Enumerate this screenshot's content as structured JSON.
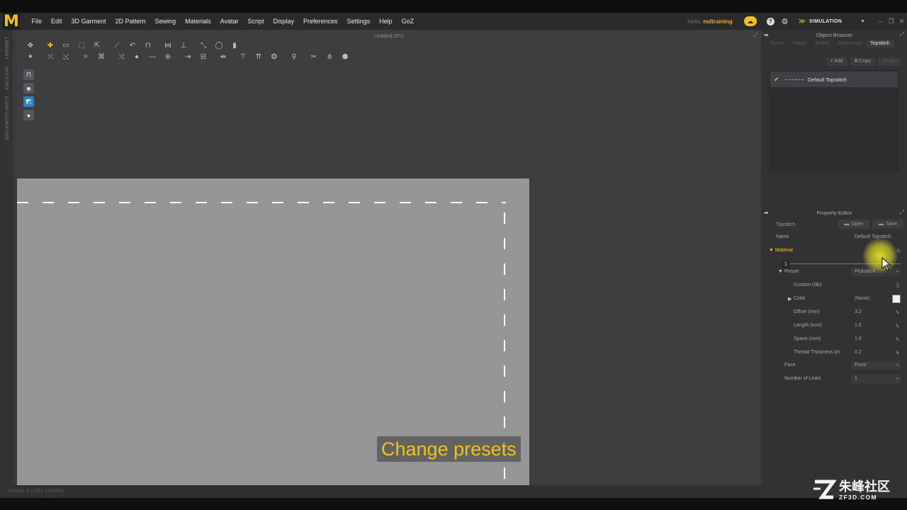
{
  "app": {
    "logo_letter": "M",
    "menu": [
      "File",
      "Edit",
      "3D Garment",
      "2D Pattern",
      "Sewing",
      "Materials",
      "Avatar",
      "Script",
      "Display",
      "Preferences",
      "Settings",
      "Help",
      "GoZ"
    ],
    "user_prefix": "Hello",
    "user_name": "mdtraining",
    "mode": "SIMULATION",
    "accent_color": "#f2c21b"
  },
  "left_strip": {
    "tabs": [
      "LIBRARY",
      "HISTORY",
      "CONFIGURATOR"
    ]
  },
  "viewport": {
    "file_title": "Untitled.ZPrj",
    "canvas_color": "#969698",
    "stitch_color": "#ffffff"
  },
  "caption": {
    "text": "Change presets"
  },
  "status": {
    "left": "Version: 5.2.383",
    "right": "(x64)Pro"
  },
  "object_browser": {
    "title": "Object Browser",
    "tabs": [
      "Scene",
      "Fabric",
      "Button",
      "Buttonhole",
      "Topstitch"
    ],
    "active_tab": "Topstitch",
    "actions": {
      "add": "Add",
      "copy": "Copy",
      "assign": "Assign"
    },
    "items": [
      {
        "label": "Default Topstitch",
        "selected": true
      }
    ]
  },
  "property_editor": {
    "title": "Property Editor",
    "object_type": "Topstitch",
    "open_label": "Open",
    "save_label": "Save",
    "name_label": "Name",
    "name_value": "Default Topstitch",
    "material_section": "Material",
    "layer_tab": "1",
    "preset_label": "Preset",
    "preset_value": "Pickstitch",
    "custom_obj_label": "Custom OBJ",
    "color_label": "Color",
    "color_value": "(None)",
    "swatch_color": "#f1f1f1",
    "offset_label": "Offset (mm)",
    "offset_value": "3.2",
    "length_label": "Length (mm)",
    "length_value": "1.6",
    "space_label": "Space (mm)",
    "space_value": "1.6",
    "thread_label": "Thread Thickness (m",
    "thread_value": "0.2",
    "face_label": "Face",
    "face_value": "Front",
    "lines_label": "Number of Lines",
    "lines_value": "1"
  },
  "watermark": {
    "cn": "朱峰社区",
    "url": "ZF3D.COM"
  }
}
